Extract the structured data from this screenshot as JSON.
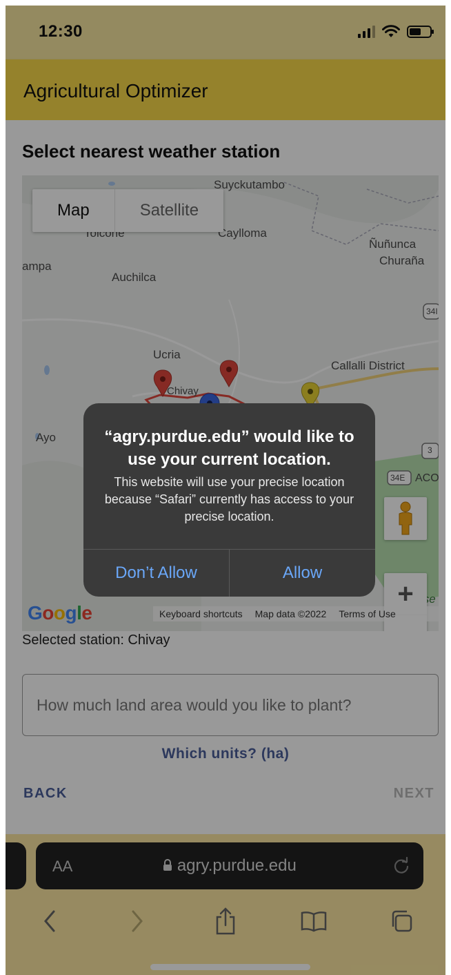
{
  "status_bar": {
    "time": "12:30",
    "icons": [
      "signal-icon",
      "wifi-icon",
      "battery-icon"
    ]
  },
  "app": {
    "title": "Agricultural Optimizer"
  },
  "page": {
    "section_title": "Select nearest weather station",
    "selected_station": "Selected station: Chivay",
    "land_placeholder": "How much land area would you like to plant?",
    "units_label": "Which units? (ha)",
    "back_label": "BACK",
    "next_label": "NEXT"
  },
  "map": {
    "toggle_map": "Map",
    "toggle_satellite": "Satellite",
    "labels": {
      "suyckutambo": "Suyckutambo",
      "tolcone": "Tolcone",
      "caylloma": "Caylloma",
      "nununca": "Ñuñunca",
      "churana": "Churaña",
      "pampa": "ampa",
      "auchilca": "Auchilca",
      "ucria": "Ucria",
      "callalli": "Callalli District",
      "ayo": "Ayo",
      "chivay": "Chivay",
      "acc": "ACO",
      "road_34": "34I",
      "road_34e": "34E",
      "road_3": "3",
      "reserve": "Rese"
    },
    "logo": "Google",
    "footer_keyboard": "Keyboard shortcuts",
    "footer_data": "Map data ©2022",
    "footer_terms": "Terms of Use",
    "zoom_in": "+",
    "zoom_out": "−",
    "markers": [
      {
        "color": "#e0473d"
      },
      {
        "color": "#e0473d"
      },
      {
        "color": "#3b66e0"
      },
      {
        "color": "#e8d235"
      }
    ]
  },
  "alert": {
    "title": "“agry.purdue.edu” would like to use your current location.",
    "message": "This website will use your precise location because “Safari” currently has access to your precise location.",
    "deny_label": "Don’t Allow",
    "allow_label": "Allow"
  },
  "safari": {
    "aa_label": "AA",
    "url": "agry.purdue.edu"
  },
  "colors": {
    "app_bar": "#f8d94a",
    "link": "#4a5e9a",
    "alert_button": "#6aa7f8"
  }
}
